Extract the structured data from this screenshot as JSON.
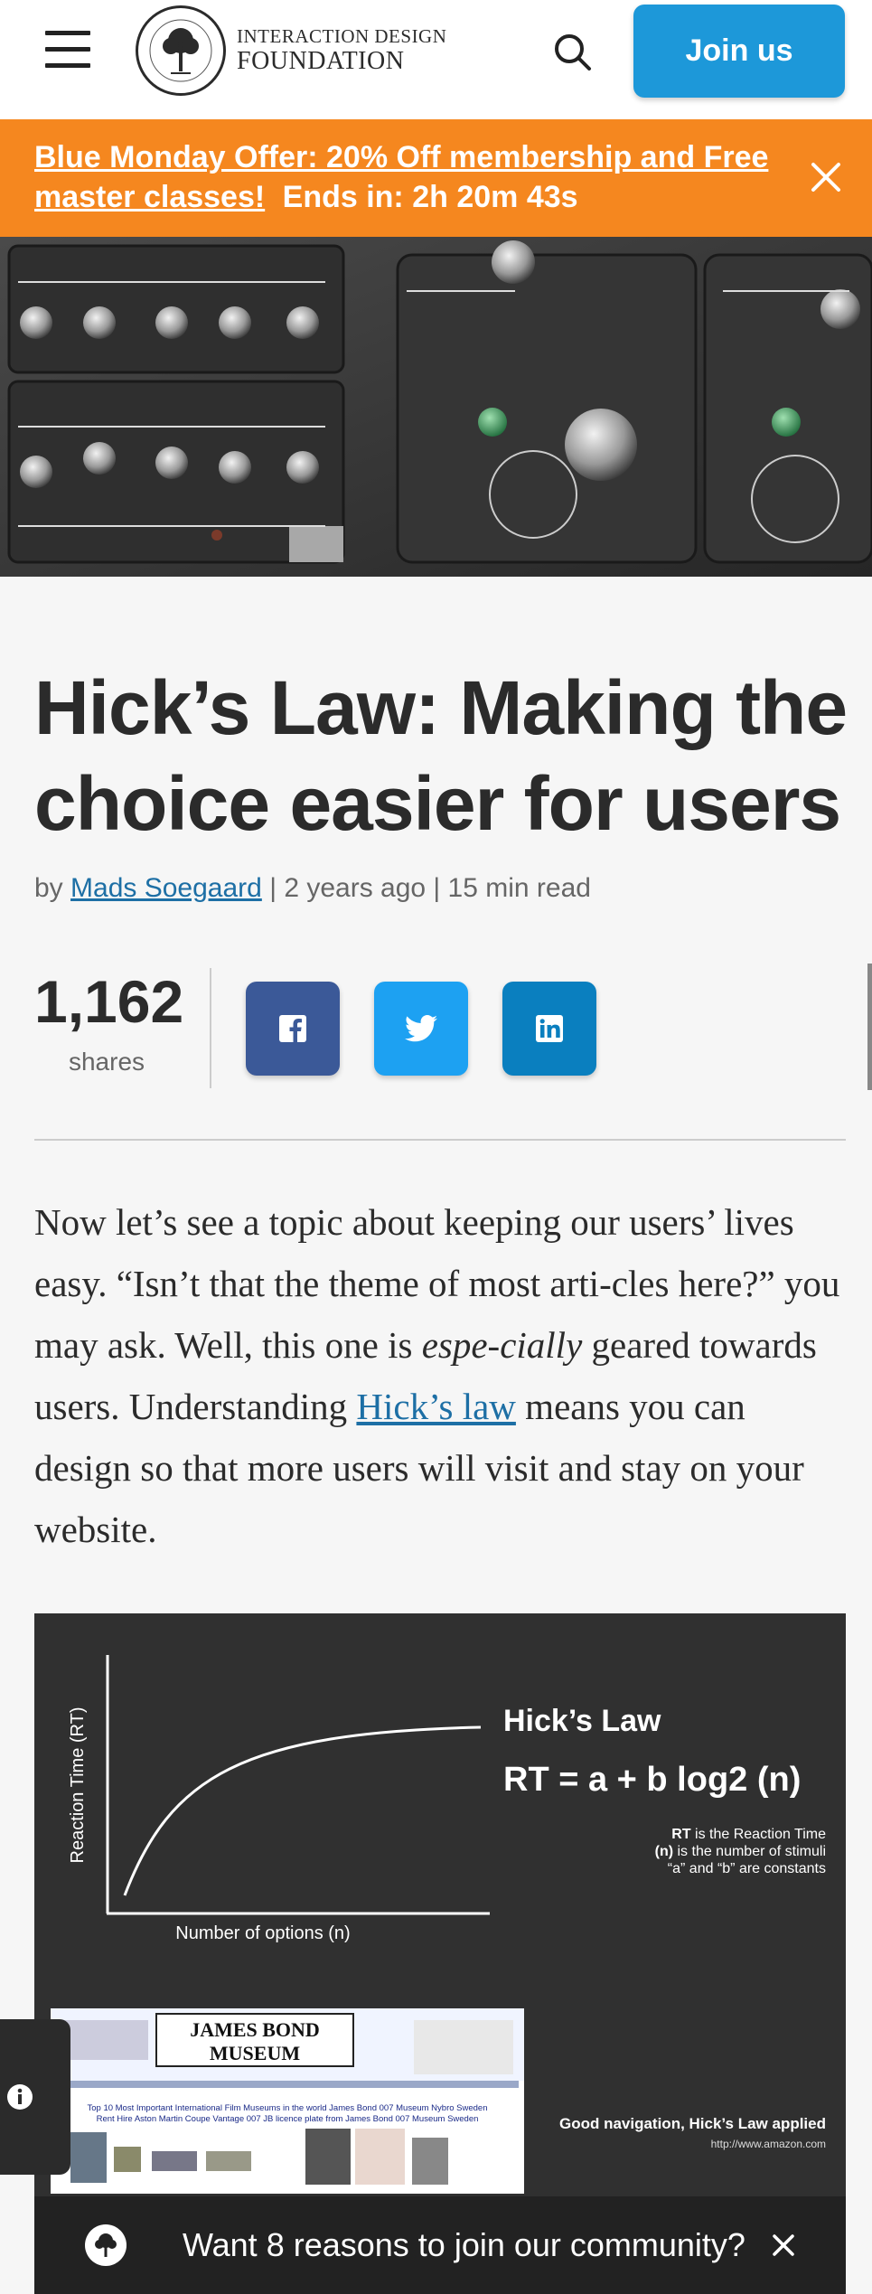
{
  "header": {
    "logo_line1": "INTERACTION DESIGN",
    "logo_line2": "FOUNDATION",
    "logo_ring_text": "INTERACTION DESIGN FOUNDATION",
    "logo_est": "Est. 2002",
    "join_label": "Join us"
  },
  "promo": {
    "offer_link": "Blue Monday Offer: 20% Off membership and Free master classes!",
    "countdown": "Ends in: 2h 20m 43s"
  },
  "article": {
    "title": "Hick’s Law: Making the choice easier for users",
    "by": "by",
    "author": "Mads Soegaard",
    "meta": "| 2 years ago | 15 min read",
    "shares_count": "1,162",
    "shares_label": "shares",
    "body_1": "Now let’s see a topic about keeping our users’ lives easy. “Isn’t that the theme of most arti-cles here?” you may ask. Well, this one is ",
    "body_em": "espe-cially",
    "body_2": " geared towards users. Understanding ",
    "body_link": "Hick’s law",
    "body_3": " means you can design so that more users will visit and stay on your website."
  },
  "figure": {
    "y_axis": "Reaction Time (RT)",
    "x_axis": "Number of options (n)",
    "law_title": "Hick’s Law",
    "formula": "RT = a + b log2 (n)",
    "legend_1b": "RT",
    "legend_1": " is the Reaction Time",
    "legend_2b": "(n)",
    "legend_2": " is the number of stimuli",
    "legend_3": "“a” and “b” are constants",
    "museum_title_1": "JAMES BOND",
    "museum_title_2": "MUSEUM",
    "museum_line": "Top 10 Most Important International Film Museums in the world James Bond 007 Museum Nybro Sweden",
    "museum_line2": "Rent Hire Aston Martin Coupe Vantage 007 JB licence plate from James Bond 007 Museum Sweden",
    "caption": "Good navigation, Hick’s Law applied",
    "source": "http://www.amazon.com"
  },
  "bottom_bar": {
    "text": "Want 8 reasons to join our community?"
  }
}
